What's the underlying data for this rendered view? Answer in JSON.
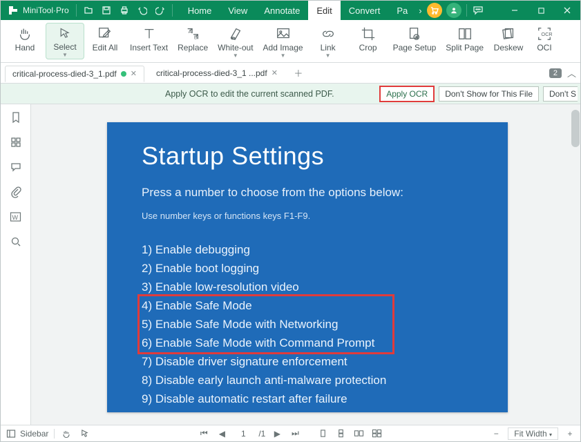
{
  "app": {
    "name": "MiniTool·Pro"
  },
  "menu": {
    "tabs": [
      "Home",
      "View",
      "Annotate",
      "Edit",
      "Convert",
      "Pa"
    ],
    "active_index": 3,
    "overflow_glyph": "›"
  },
  "ribbon": {
    "items": [
      {
        "key": "hand",
        "label": "Hand",
        "caret": false,
        "icon": "hand-icon"
      },
      {
        "key": "select",
        "label": "Select",
        "caret": true,
        "icon": "cursor-icon",
        "selected": true
      },
      {
        "key": "editall",
        "label": "Edit All",
        "caret": false,
        "icon": "edit-all-icon"
      },
      {
        "key": "inserttext",
        "label": "Insert Text",
        "caret": false,
        "icon": "insert-text-icon"
      },
      {
        "key": "replace",
        "label": "Replace",
        "caret": false,
        "icon": "replace-icon"
      },
      {
        "key": "whiteout",
        "label": "White-out",
        "caret": true,
        "icon": "whiteout-icon"
      },
      {
        "key": "addimage",
        "label": "Add Image",
        "caret": true,
        "icon": "image-icon"
      },
      {
        "key": "link",
        "label": "Link",
        "caret": true,
        "icon": "link-icon"
      },
      {
        "key": "crop",
        "label": "Crop",
        "caret": false,
        "icon": "crop-icon"
      },
      {
        "key": "pagesetup",
        "label": "Page Setup",
        "caret": false,
        "icon": "page-setup-icon"
      },
      {
        "key": "splitpage",
        "label": "Split Page",
        "caret": false,
        "icon": "split-page-icon"
      },
      {
        "key": "deskew",
        "label": "Deskew",
        "caret": false,
        "icon": "deskew-icon"
      },
      {
        "key": "ocr",
        "label": "OCI",
        "caret": false,
        "icon": "ocr-icon"
      }
    ]
  },
  "tabs": {
    "items": [
      {
        "name": "critical-process-died-3_1.pdf",
        "modified": true,
        "active": true
      },
      {
        "name": "critical-process-died-3_1 ...pdf",
        "modified": false,
        "active": false
      }
    ],
    "badge": "2"
  },
  "ocr": {
    "message": "Apply OCR to edit the current scanned PDF.",
    "apply_label": "Apply OCR",
    "dismiss_label": "Don't Show for This File",
    "truncated_label": "Don't S"
  },
  "sidebar": {
    "items": [
      {
        "key": "bookmark",
        "name": "bookmark-icon"
      },
      {
        "key": "thumbnails",
        "name": "thumbnails-icon"
      },
      {
        "key": "comments",
        "name": "comment-icon"
      },
      {
        "key": "attachments",
        "name": "attachment-icon"
      },
      {
        "key": "word",
        "name": "word-icon"
      },
      {
        "key": "search",
        "name": "search-icon"
      }
    ]
  },
  "document": {
    "bg": "#1f6bb8",
    "title": "Startup Settings",
    "subtitle": "Press a number to choose from the options below:",
    "hint": "Use number keys or functions keys F1-F9.",
    "options": [
      "1) Enable debugging",
      "2) Enable boot logging",
      "3) Enable low-resolution video",
      "4) Enable Safe Mode",
      "5) Enable Safe Mode with Networking",
      "6) Enable Safe Mode with Command Prompt",
      "7) Disable driver signature enforcement",
      "8) Disable early launch anti-malware protection",
      "9) Disable automatic restart after failure"
    ],
    "highlight": {
      "start_index": 3,
      "end_index": 5
    }
  },
  "status": {
    "sidebar_label": "Sidebar",
    "page_current": "1",
    "page_total": "/1",
    "zoom_mode": "Fit Width",
    "minus": "−",
    "plus": "+"
  }
}
